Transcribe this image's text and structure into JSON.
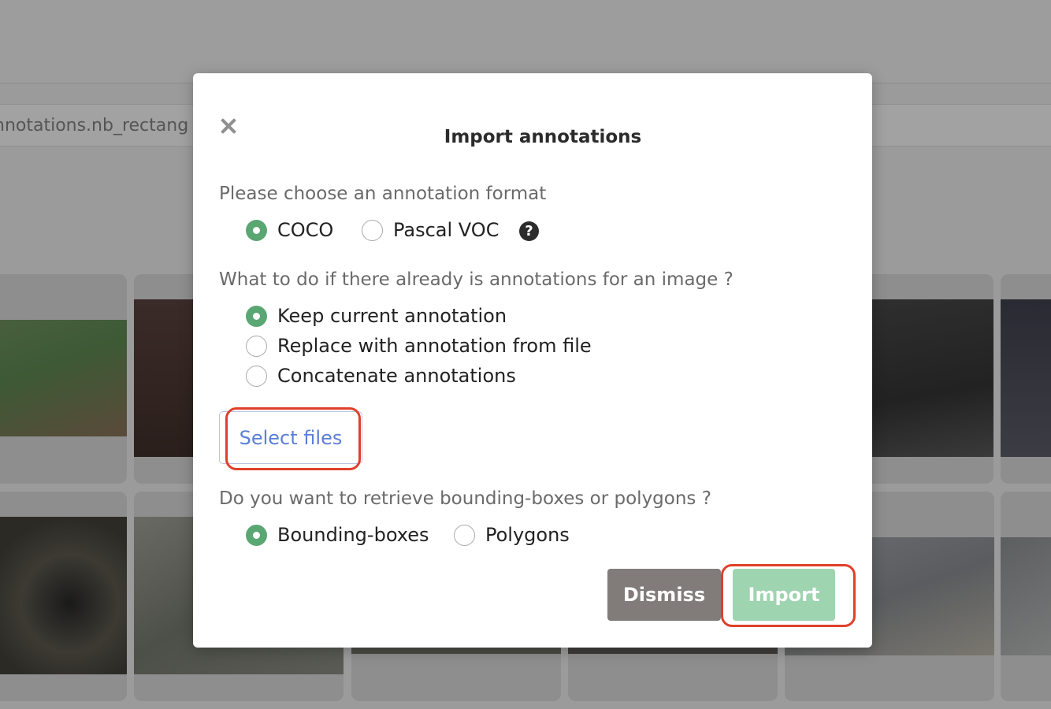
{
  "background": {
    "filename_text": "nnotations.nb_rectang"
  },
  "modal": {
    "title": "Import annotations",
    "format": {
      "label": "Please choose an annotation format",
      "options": [
        "COCO",
        "Pascal VOC"
      ],
      "selected": "COCO"
    },
    "existing": {
      "label": "What to do if there already is annotations for an image ?",
      "options": [
        "Keep current annotation",
        "Replace with annotation from file",
        "Concatenate annotations"
      ],
      "selected": "Keep current annotation"
    },
    "select_files_label": "Select files",
    "shape": {
      "label": "Do you want to retrieve bounding-boxes or polygons ?",
      "options": [
        "Bounding-boxes",
        "Polygons"
      ],
      "selected": "Bounding-boxes"
    },
    "dismiss_label": "Dismiss",
    "import_label": "Import",
    "help_icon_glyph": "?"
  },
  "colors": {
    "radio_checked": "#5aa774",
    "import_button": "#9ed4b0",
    "dismiss_button": "#817c7a",
    "select_files_text": "#5b7fd6",
    "highlight": "#e0402a"
  },
  "icons": {
    "close": "close-icon",
    "help": "question-circle-icon"
  }
}
